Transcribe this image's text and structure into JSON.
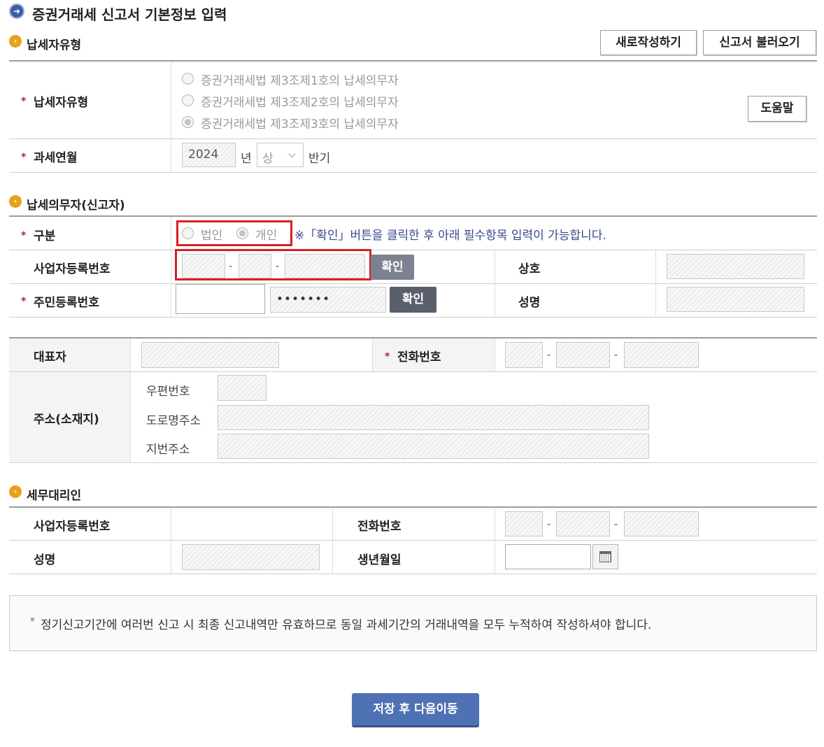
{
  "page": {
    "title": "증권거래세 신고서 기본정보 입력"
  },
  "sections": {
    "taxpayer_type": "납세자유형",
    "obligor": "납세의무자(신고자)",
    "agent": "세무대리인"
  },
  "buttons": {
    "new": "새로작성하기",
    "load": "신고서 불러오기",
    "help": "도움말",
    "confirm": "확인",
    "save_next": "저장 후 다음이동"
  },
  "taxpayer": {
    "label": "납세자유형",
    "options": [
      "증권거래세법 제3조제1호의 납세의무자",
      "증권거래세법 제3조제2호의 납세의무자",
      "증권거래세법 제3조제3호의 납세의무자"
    ],
    "selected_index": 2,
    "year_label": "과세연월",
    "year": "2024",
    "year_suffix": "년",
    "half": "상",
    "half_suffix": "반기"
  },
  "obligor": {
    "type_label": "구분",
    "type_options": [
      "법인",
      "개인"
    ],
    "type_selected": "개인",
    "notice": "※「확인」버튼을 클릭한 후 아래 필수항목 입력이 가능합니다.",
    "biz_no_label": "사업자등록번호",
    "trade_name_label": "상호",
    "rrn_label": "주민등록번호",
    "rrn_masked": "•••••••",
    "name_label": "성명",
    "rep_label": "대표자",
    "phone_label": "전화번호",
    "address_label": "주소(소재지)",
    "zip_label": "우편번호",
    "road_label": "도로명주소",
    "lot_label": "지번주소",
    "dash": "-"
  },
  "agent": {
    "biz_no_label": "사업자등록번호",
    "phone_label": "전화번호",
    "name_label": "성명",
    "birth_label": "생년월일"
  },
  "notice": "정기신고기간에 여러번 신고 시 최종 신고내역만 유효하므로 동일 과세기간의 거래내역을 모두 누적하여 작성하셔야 합니다.",
  "required_mark": "*",
  "colors": {
    "required": "#b4282e",
    "highlight": "#d62023",
    "primary_button": "#4f72b5",
    "notice_text": "#3a4a8a"
  }
}
